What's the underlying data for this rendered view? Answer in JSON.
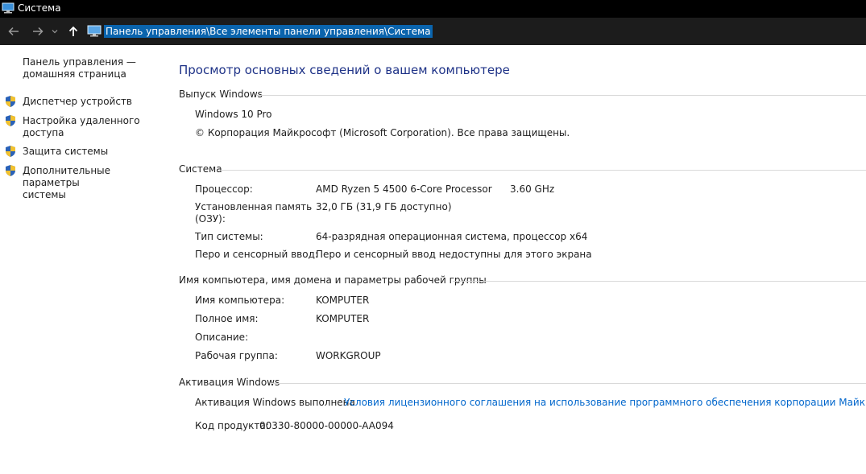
{
  "window": {
    "title": "Система"
  },
  "address_bar": {
    "path": "Панель управления\\Все элементы панели управления\\Система"
  },
  "sidebar": {
    "home_link": "Панель управления — домашняя страница",
    "home_line1": "Панель управления —",
    "home_line2": "домашняя страница",
    "items": [
      {
        "line1": "Диспетчер устройств",
        "line2": ""
      },
      {
        "line1": "Настройка удаленного",
        "line2": "доступа"
      },
      {
        "line1": "Защита системы",
        "line2": ""
      },
      {
        "line1": "Дополнительные параметры",
        "line2": "системы"
      }
    ]
  },
  "main": {
    "title": "Просмотр основных сведений о вашем компьютере",
    "edition": {
      "header": "Выпуск Windows",
      "name": "Windows 10 Pro",
      "copyright": "© Корпорация Майкрософт (Microsoft Corporation). Все права защищены."
    },
    "system": {
      "header": "Система",
      "processor_label": "Процессор:",
      "processor_value": "AMD Ryzen 5 4500 6-Core Processor",
      "processor_speed": "3.60 GHz",
      "memory_label_line1": "Установленная память",
      "memory_label_line2": "(ОЗУ):",
      "memory_value": "32,0 ГБ (31,9 ГБ доступно)",
      "type_label": "Тип системы:",
      "type_value": "64-разрядная операционная система, процессор x64",
      "pen_label": "Перо и сенсорный ввод:",
      "pen_value": "Перо и сенсорный ввод недоступны для этого экрана"
    },
    "computer": {
      "header": "Имя компьютера, имя домена и параметры рабочей группы",
      "name_label": "Имя компьютера:",
      "name_value": "KOMPUTER",
      "full_label": "Полное имя:",
      "full_value": "KOMPUTER",
      "desc_label": "Описание:",
      "desc_value": "",
      "group_label": "Рабочая группа:",
      "group_value": "WORKGROUP"
    },
    "activation": {
      "header": "Активация Windows",
      "status": "Активация Windows выполнена",
      "license_link": "Условия лицензионного соглашения на использование программного обеспечения корпорации Майкрософт",
      "product_label": "Код продукта:",
      "product_value": "00330-80000-00000-AA094"
    }
  },
  "colors": {
    "title_blue": "#1e3287",
    "link_blue": "#0066cc",
    "selection_blue": "#0a64ad"
  }
}
